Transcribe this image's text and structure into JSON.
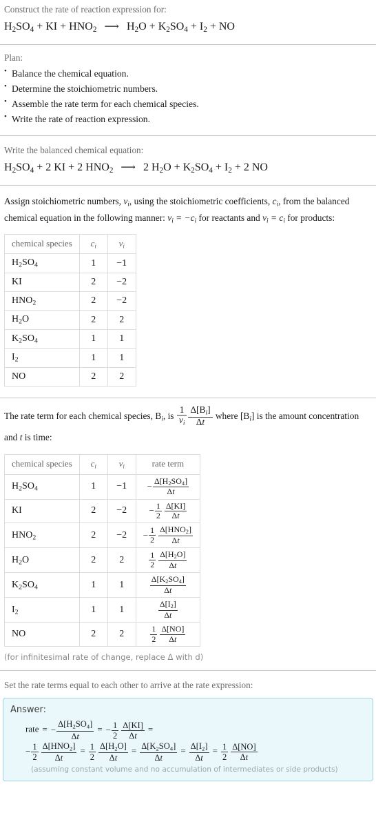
{
  "header": {
    "prompt": "Construct the rate of reaction expression for:",
    "equation": {
      "reactants": [
        "H2SO4",
        "KI",
        "HNO2"
      ],
      "products": [
        "H2O",
        "K2SO4",
        "I2",
        "NO"
      ],
      "arrow": "⟶",
      "text": "H_2SO_4 + KI + HNO_2  ⟶  H_2O + K_2SO_4 + I_2 + NO"
    }
  },
  "plan": {
    "label": "Plan:",
    "items": [
      "Balance the chemical equation.",
      "Determine the stoichiometric numbers.",
      "Assemble the rate term for each chemical species.",
      "Write the rate of reaction expression."
    ]
  },
  "balanced": {
    "label": "Write the balanced chemical equation:",
    "text": "H_2SO_4 + 2 KI + 2 HNO_2  ⟶  2 H_2O + K_2SO_4 + I_2 + 2 NO",
    "coefficients": {
      "H2SO4": 1,
      "KI": 2,
      "HNO2": 2,
      "H2O": 2,
      "K2SO4": 1,
      "I2": 1,
      "NO": 2
    }
  },
  "stoich": {
    "paragraph_part1": "Assign stoichiometric numbers, ",
    "paragraph_part2": ", using the stoichiometric coefficients, ",
    "paragraph_part3": ", from the balanced chemical equation in the following manner: ",
    "paragraph_part4": " for reactants and ",
    "paragraph_part5": " for products:",
    "nu_symbol": "ν",
    "c_symbol": "c",
    "i_symbol": "i",
    "rule_reactants": "νᵢ = −cᵢ",
    "rule_products": "νᵢ = cᵢ"
  },
  "table1": {
    "headers": [
      "chemical species",
      "c",
      "ν"
    ],
    "rows": [
      {
        "species": "H2SO4",
        "c": "1",
        "nu": "−1"
      },
      {
        "species": "KI",
        "c": "2",
        "nu": "−2"
      },
      {
        "species": "HNO2",
        "c": "2",
        "nu": "−2"
      },
      {
        "species": "H2O",
        "c": "2",
        "nu": "2"
      },
      {
        "species": "K2SO4",
        "c": "1",
        "nu": "1"
      },
      {
        "species": "I2",
        "c": "1",
        "nu": "1"
      },
      {
        "species": "NO",
        "c": "2",
        "nu": "2"
      }
    ]
  },
  "rateterm": {
    "text_part1": "The rate term for each chemical species, ",
    "text_part2": ", is ",
    "text_part3": " where ",
    "text_part4": " is the amount concentration and ",
    "text_part5": " is time:",
    "B_symbol": "B",
    "t_symbol": "t",
    "frac_num": "1",
    "frac_den": "νᵢ",
    "delta_num": "Δ[Bᵢ]",
    "delta_den": "Δt",
    "bracket_B": "[Bᵢ]"
  },
  "table2": {
    "headers": [
      "chemical species",
      "c",
      "ν",
      "rate term"
    ],
    "rows": [
      {
        "species": "H2SO4",
        "c": "1",
        "nu": "−1",
        "sign": "−",
        "coef_num": "",
        "coef_den": "",
        "delta": "Δ[H2SO4]",
        "dt": "Δt"
      },
      {
        "species": "KI",
        "c": "2",
        "nu": "−2",
        "sign": "−",
        "coef_num": "1",
        "coef_den": "2",
        "delta": "Δ[KI]",
        "dt": "Δt"
      },
      {
        "species": "HNO2",
        "c": "2",
        "nu": "−2",
        "sign": "−",
        "coef_num": "1",
        "coef_den": "2",
        "delta": "Δ[HNO2]",
        "dt": "Δt"
      },
      {
        "species": "H2O",
        "c": "2",
        "nu": "2",
        "sign": "",
        "coef_num": "1",
        "coef_den": "2",
        "delta": "Δ[H2O]",
        "dt": "Δt"
      },
      {
        "species": "K2SO4",
        "c": "1",
        "nu": "1",
        "sign": "",
        "coef_num": "",
        "coef_den": "",
        "delta": "Δ[K2SO4]",
        "dt": "Δt"
      },
      {
        "species": "I2",
        "c": "1",
        "nu": "1",
        "sign": "",
        "coef_num": "",
        "coef_den": "",
        "delta": "Δ[I2]",
        "dt": "Δt"
      },
      {
        "species": "NO",
        "c": "2",
        "nu": "2",
        "sign": "",
        "coef_num": "1",
        "coef_den": "2",
        "delta": "Δ[NO]",
        "dt": "Δt"
      }
    ],
    "footnote": "(for infinitesimal rate of change, replace Δ with d)"
  },
  "final": {
    "label": "Set the rate terms equal to each other to arrive at the rate expression:",
    "answer_label": "Answer:",
    "rate_word": "rate",
    "equals": "=",
    "assumption": "(assuming constant volume and no accumulation of intermediates or side products)"
  },
  "colors": {
    "answer_bg": "#eaf8fc",
    "answer_border": "#9fd4e3",
    "divider": "#c8c8c8",
    "label_text": "#6b6b6b",
    "body_text": "#1a1a1a",
    "note_text": "#8a8a8a"
  }
}
